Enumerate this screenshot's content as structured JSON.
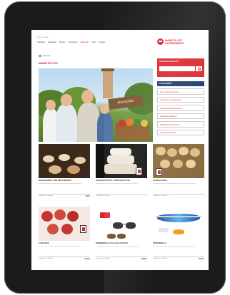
{
  "header": {
    "meta": "Login | Kontakt",
    "nav": [
      "Startseite",
      "Marktplatz",
      "Partner",
      "Gutscheine",
      "Marktplatz",
      "Jobs",
      "Kontakt"
    ],
    "active_index": 4,
    "logo_line1": "MARKTPLATZ",
    "logo_line2": "KAISERSBERG"
  },
  "breadcrumb": "Marktplatz",
  "page_title": "MARKTPLATZ",
  "hero": {
    "sign_text": "Marktplatz"
  },
  "search": {
    "title": "SUCHE MARKTPLATZ",
    "placeholder": ""
  },
  "categories": {
    "heading": "KATEGORIEN",
    "items": [
      "Lebensmittel & Getränke",
      "Gastronomie & Gastronomie",
      "Gesundheit & Wohlbefinden",
      "Haushalt & Handwerk",
      "Bekleidung & Accessoires",
      "Spielzeug & Hobbies"
    ]
  },
  "products": [
    {
      "name": "WILDSCHWEIN- UND HIRSCHWURST",
      "foot": "Lieferbar in 1 Woche",
      "price": "4,50 €"
    },
    {
      "name": "HOCHZEITSTORTE - BIRKENBLÄTTER",
      "foot": "Lieferbar in 1 Woche",
      "price": "--"
    },
    {
      "name": "HONIGKUCHEN",
      "foot": "Lieferbar in 1 Woche",
      "price": "--"
    },
    {
      "name": "CUPCAKES",
      "foot": "Lieferbar in 1 Woche",
      "price": "24,00 €"
    },
    {
      "name": "SONNENBRILLE RAY-BAN AVIATOR",
      "foot": "Lieferbar in 1 Woche",
      "price": "89,00 €"
    },
    {
      "name": "SPORTBRILLE",
      "foot": "Lieferbar in 1 Woche",
      "price": "69,00 €"
    }
  ],
  "colors": {
    "brand_red": "#d9262c",
    "navy": "#1f3a6a"
  }
}
